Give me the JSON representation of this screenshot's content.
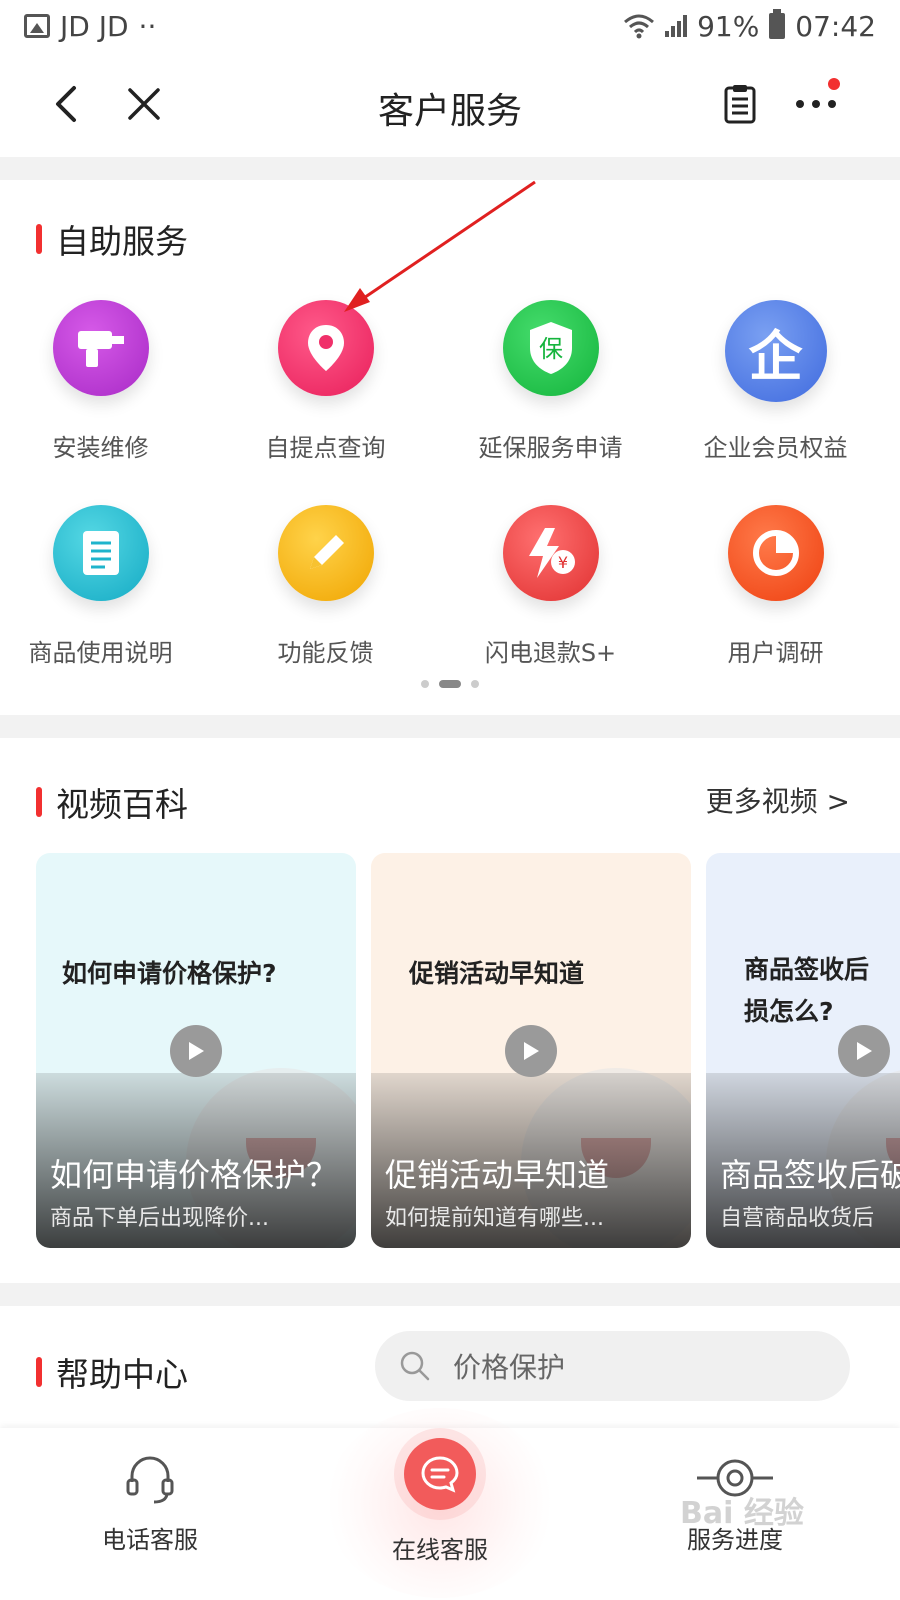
{
  "status_bar": {
    "carrier": "JD JD",
    "dots": "··",
    "battery": "91%",
    "time": "07:42"
  },
  "header": {
    "title": "客户服务",
    "back_icon": "chevron-left-icon",
    "close_icon": "close-icon",
    "orders_icon": "clipboard-icon",
    "more_icon": "more-dots-icon"
  },
  "self_service": {
    "title": "自助服务",
    "items": [
      {
        "label": "安装维修",
        "icon": "drill-icon",
        "color": "#b733d6"
      },
      {
        "label": "自提点查询",
        "icon": "location-pin-icon",
        "color": "#f0306a"
      },
      {
        "label": "延保服务申请",
        "icon": "shield-bao-icon",
        "color": "#1bc24a"
      },
      {
        "label": "企业会员权益",
        "icon": "enterprise-qi-icon",
        "color": "#4c7be6"
      },
      {
        "label": "商品使用说明",
        "icon": "document-icon",
        "color": "#22bcd0"
      },
      {
        "label": "功能反馈",
        "icon": "pencil-icon",
        "color": "#f5b416"
      },
      {
        "label": "闪电退款S+",
        "icon": "lightning-yen-icon",
        "color": "#f04848"
      },
      {
        "label": "用户调研",
        "icon": "pie-chart-icon",
        "color": "#f25020"
      }
    ],
    "icon_glyphs": {
      "bao": "保",
      "qi": "企",
      "yen": "¥"
    }
  },
  "video": {
    "title": "视频百科",
    "more": "更多视频 >",
    "cards": [
      {
        "title": "如何申请价格保护?",
        "caption": "如何申请价格保护？",
        "subtitle": "商品下单后出现降价...",
        "bg": "#e6f8fa"
      },
      {
        "title": "促销活动早知道",
        "caption": "促销活动早知道",
        "subtitle": "如何提前知道有哪些...",
        "bg": "#fdf1e6"
      },
      {
        "title": "商品签收后\n损怎么?",
        "caption": "商品签收后破",
        "subtitle": "自营商品收货后",
        "bg": "#e9f0fb"
      }
    ]
  },
  "help": {
    "title": "帮助中心",
    "search_placeholder": "价格保护"
  },
  "bottom_bar": {
    "phone": "电话客服",
    "online": "在线客服",
    "progress": "服务进度"
  },
  "watermark": "Bai 经验"
}
